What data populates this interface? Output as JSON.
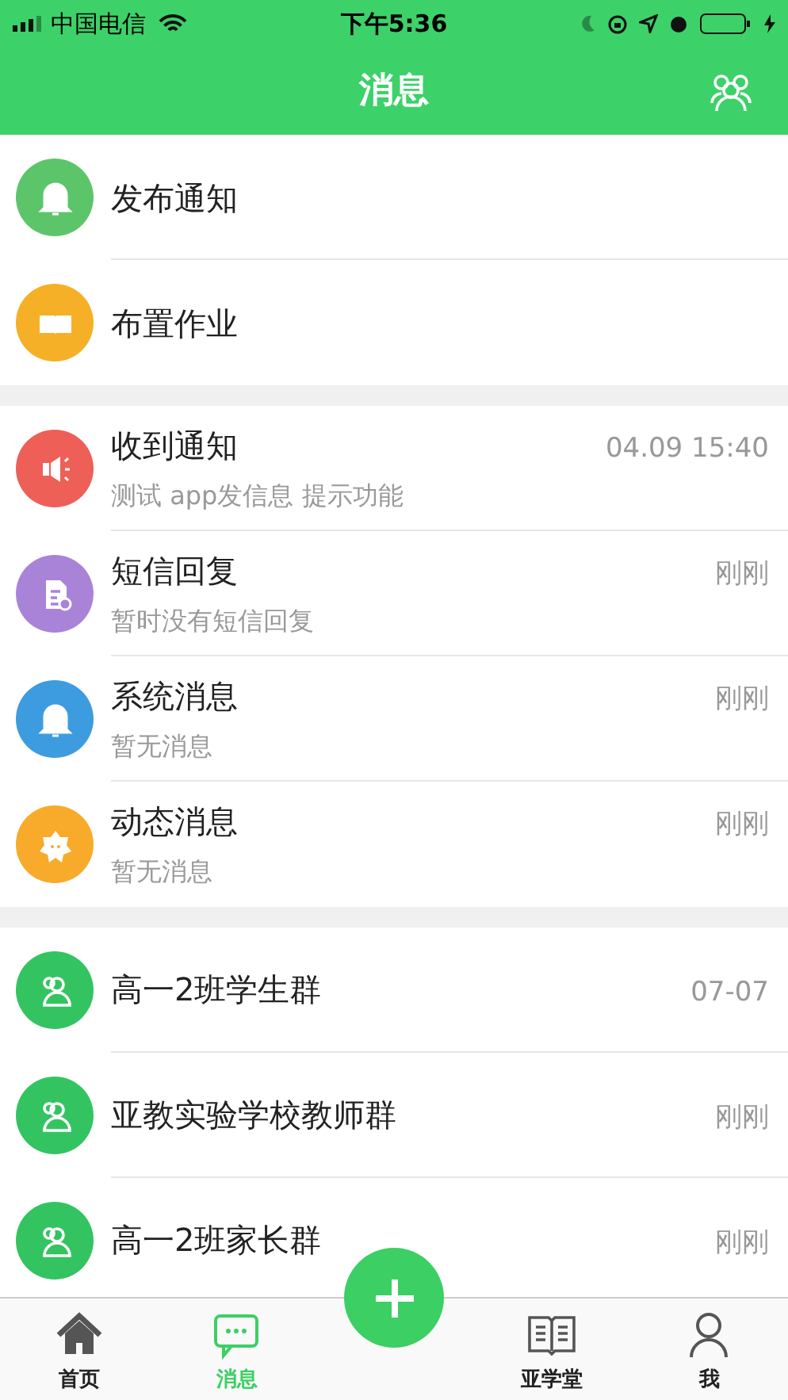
{
  "status_bar": {
    "carrier": "中国电信",
    "time": "下午5:36"
  },
  "header": {
    "title": "消息"
  },
  "sections": [
    {
      "items": [
        {
          "kind": "bell",
          "color": "#5cc56a",
          "title": "发布通知"
        },
        {
          "kind": "book",
          "color": "#f6b027",
          "title": "布置作业"
        }
      ]
    },
    {
      "items": [
        {
          "kind": "megaphone",
          "color": "#ee5f57",
          "title": "收到通知",
          "subtitle": "测试 app发信息 提示功能",
          "time": "04.09 15:40"
        },
        {
          "kind": "document",
          "color": "#a983d8",
          "title": "短信回复",
          "subtitle": "暂时没有短信回复",
          "time": "刚刚"
        },
        {
          "kind": "bell",
          "color": "#3d9be0",
          "title": "系统消息",
          "subtitle": "暂无消息",
          "time": "刚刚"
        },
        {
          "kind": "flower",
          "color": "#f8ab2a",
          "title": "动态消息",
          "subtitle": "暂无消息",
          "time": "刚刚"
        }
      ]
    },
    {
      "items": [
        {
          "kind": "group",
          "color": "#33c461",
          "title": "高一2班学生群",
          "time": "07-07"
        },
        {
          "kind": "group",
          "color": "#33c461",
          "title": "亚教实验学校教师群",
          "time": "刚刚"
        },
        {
          "kind": "group",
          "color": "#33c461",
          "title": "高一2班家长群",
          "time": "刚刚"
        }
      ]
    }
  ],
  "tabs": [
    {
      "kind": "home",
      "label": "首页",
      "selected": false
    },
    {
      "kind": "chat",
      "label": "消息",
      "selected": true
    },
    {
      "kind": "book",
      "label": "亚学堂",
      "selected": false
    },
    {
      "kind": "person",
      "label": "我",
      "selected": false
    }
  ]
}
